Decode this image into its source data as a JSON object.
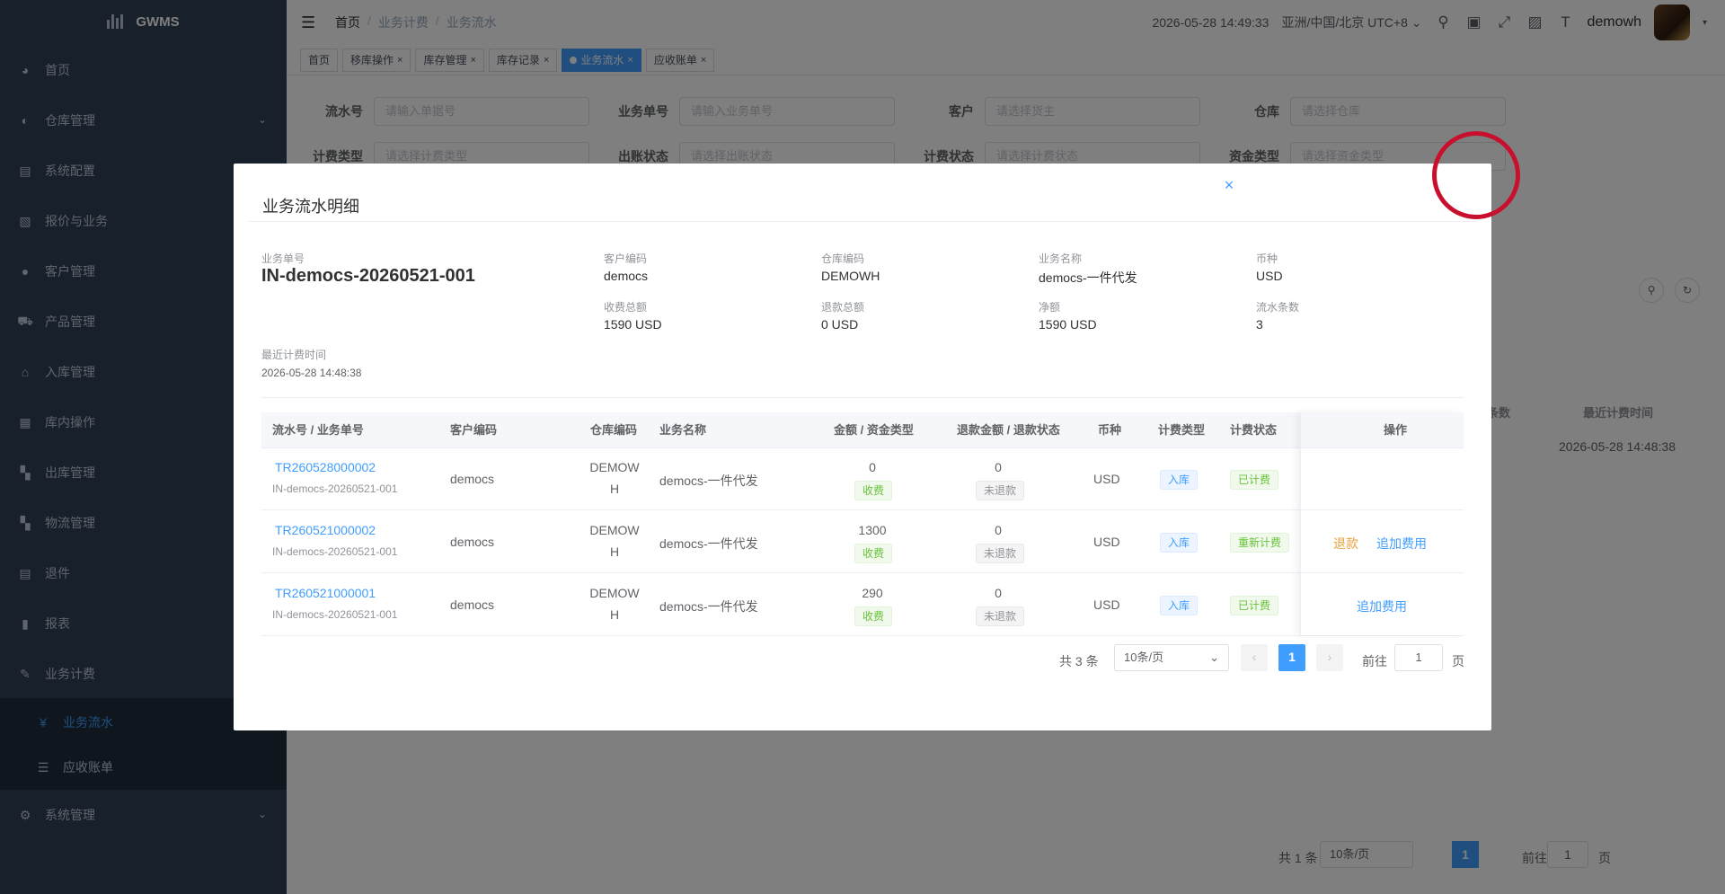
{
  "logo": {
    "text": "GWMS"
  },
  "sidebar": {
    "items": [
      {
        "label": "首页",
        "icon": "dashboard-icon"
      },
      {
        "label": "仓库管理",
        "icon": "warehouse-icon"
      },
      {
        "label": "系统配置",
        "icon": "config-icon"
      },
      {
        "label": "报价与业务",
        "icon": "quote-icon"
      },
      {
        "label": "客户管理",
        "icon": "user-icon"
      },
      {
        "label": "产品管理",
        "icon": "cart-icon"
      },
      {
        "label": "入库管理",
        "icon": "inbound-icon"
      },
      {
        "label": "库内操作",
        "icon": "grid-icon"
      },
      {
        "label": "出库管理",
        "icon": "outbound-icon"
      },
      {
        "label": "物流管理",
        "icon": "logistics-icon"
      },
      {
        "label": "退件",
        "icon": "return-icon"
      },
      {
        "label": "报表",
        "icon": "chart-icon"
      },
      {
        "label": "业务计费",
        "icon": "billing-icon"
      },
      {
        "label": "系统管理",
        "icon": "gear-icon"
      }
    ],
    "sub_items": [
      {
        "label": "业务流水",
        "icon": "yen-icon"
      },
      {
        "label": "应收账单",
        "icon": "list-icon"
      }
    ]
  },
  "header": {
    "breadcrumb": [
      "首页",
      "业务计费",
      "业务流水"
    ],
    "datetime": "2026-05-28 14:49:33",
    "timezone": "亚洲/中国/北京 UTC+8",
    "username": "demowh"
  },
  "tags": [
    {
      "label": "首页"
    },
    {
      "label": "移库操作"
    },
    {
      "label": "库存管理"
    },
    {
      "label": "库存记录"
    },
    {
      "label": "业务流水"
    },
    {
      "label": "应收账单"
    }
  ],
  "search_form": {
    "row1": [
      {
        "label": "流水号",
        "placeholder": "请输入单据号"
      },
      {
        "label": "业务单号",
        "placeholder": "请输入业务单号"
      },
      {
        "label": "客户",
        "placeholder": "请选择货主"
      },
      {
        "label": "仓库",
        "placeholder": "请选择仓库"
      }
    ],
    "row2": [
      {
        "label": "计费类型",
        "placeholder": "请选择计费类型"
      },
      {
        "label": "出账状态",
        "placeholder": "请选择出账状态"
      },
      {
        "label": "计费状态",
        "placeholder": "请选择计费状态"
      },
      {
        "label": "资金类型",
        "placeholder": "请选择资金类型"
      }
    ]
  },
  "background_table": {
    "header_partial": "条数",
    "header_last_billing": "最近计费时间",
    "row_last_billing": "2026-05-28 14:48:38",
    "pagination": {
      "total": "共 1 条",
      "page_size": "10条/页",
      "page": "1",
      "goto_label": "前往",
      "goto_value": "1",
      "page_unit": "页"
    }
  },
  "dialog": {
    "title": "业务流水明细",
    "info": {
      "biz_no_label": "业务单号",
      "biz_no": "IN-democs-20260521-001",
      "customer_code_label": "客户编码",
      "customer_code": "democs",
      "warehouse_code_label": "仓库编码",
      "warehouse_code": "DEMOWH",
      "biz_name_label": "业务名称",
      "biz_name": "democs-一件代发",
      "currency_label": "币种",
      "currency": "USD",
      "charge_total_label": "收费总额",
      "charge_total": "1590 USD",
      "refund_total_label": "退款总额",
      "refund_total": "0 USD",
      "net_label": "净额",
      "net": "1590 USD",
      "count_label": "流水条数",
      "count": "3",
      "last_billing_label": "最近计费时间",
      "last_billing": "2026-05-28 14:48:38"
    },
    "table": {
      "columns": [
        "流水号 / 业务单号",
        "客户编码",
        "仓库编码",
        "业务名称",
        "金额 / 资金类型",
        "退款金额 / 退款状态",
        "币种",
        "计费类型",
        "计费状态",
        "操作"
      ],
      "rows": [
        {
          "flow_no": "TR260528000002",
          "biz_no": "IN-democs-20260521-001",
          "customer": "democs",
          "wh1": "DEMOW",
          "wh2": "H",
          "biz_name": "democs-一件代发",
          "amount": "0",
          "fund_type": "收费",
          "refund": "0",
          "refund_status": "未退款",
          "currency": "USD",
          "billing_type": "入库",
          "billing_status": "已计费",
          "ops": []
        },
        {
          "flow_no": "TR260521000002",
          "biz_no": "IN-democs-20260521-001",
          "customer": "democs",
          "wh1": "DEMOW",
          "wh2": "H",
          "biz_name": "democs-一件代发",
          "amount": "1300",
          "fund_type": "收费",
          "refund": "0",
          "refund_status": "未退款",
          "currency": "USD",
          "billing_type": "入库",
          "billing_status": "重新计费",
          "ops": [
            "退款",
            "追加费用"
          ]
        },
        {
          "flow_no": "TR260521000001",
          "biz_no": "IN-democs-20260521-001",
          "customer": "democs",
          "wh1": "DEMOW",
          "wh2": "H",
          "biz_name": "democs-一件代发",
          "amount": "290",
          "fund_type": "收费",
          "refund": "0",
          "refund_status": "未退款",
          "currency": "USD",
          "billing_type": "入库",
          "billing_status": "已计费",
          "ops": [
            "追加费用"
          ]
        }
      ]
    },
    "pagination": {
      "total": "共 3 条",
      "page_size": "10条/页",
      "page": "1",
      "goto_label": "前往",
      "goto_value": "1",
      "page_unit": "页"
    }
  },
  "colors": {
    "sidebar_bg": "#304156",
    "accent": "#409eff",
    "warning": "#e6a23c",
    "success": "#67c23a",
    "highlight_ring": "#c8102e"
  }
}
